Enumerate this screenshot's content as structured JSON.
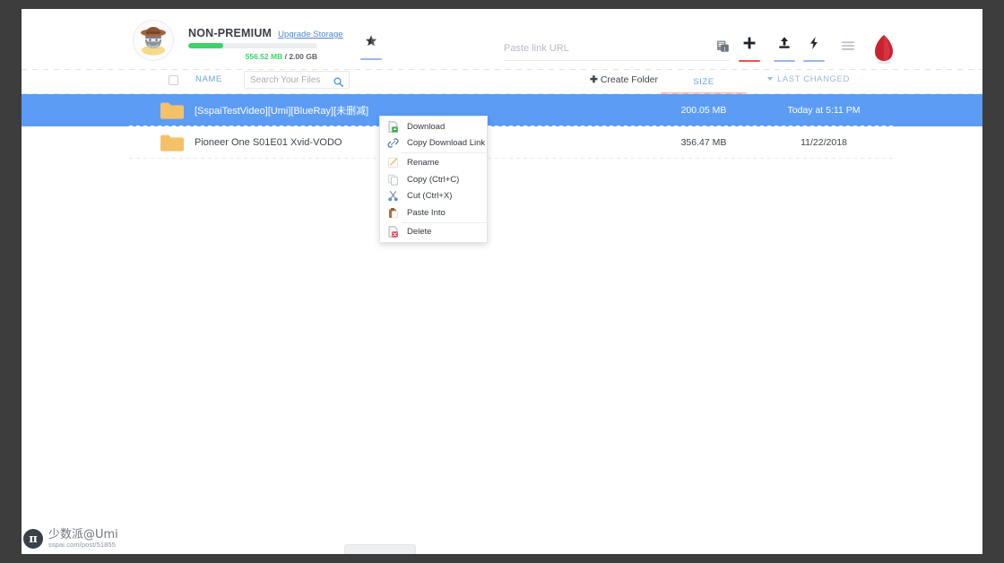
{
  "account": {
    "plan_name": "NON-PREMIUM",
    "upgrade_label": "Upgrade Storage",
    "storage_used": "556.52 MB",
    "storage_sep": "/",
    "storage_total": "2.00 GB",
    "storage_percent": 27,
    "avatar_alt": "user-avatar"
  },
  "toolbar": {
    "star_icon": "star-icon",
    "link_input_placeholder": "Paste link URL",
    "link_input_value": "",
    "paste_icon": "paste-clipboard-icon",
    "add_icon": "plus-icon",
    "upload_icon": "upload-icon",
    "bolt_icon": "lightning-bolt-icon",
    "menu_icon": "hamburger-menu-icon",
    "logo_icon": "red-leaf-logo"
  },
  "table": {
    "select_all_checked": false,
    "col_name": "NAME",
    "search_placeholder": "Search Your Files",
    "search_value": "",
    "search_icon": "search-icon",
    "create_folder_label": "Create Folder",
    "create_folder_plus": "✚",
    "col_size": "SIZE",
    "col_last_changed": "LAST CHANGED",
    "sort_active_column": "SIZE",
    "rows": [
      {
        "name": "[SspaiTestVideo][Umi][BlueRay][未删减]",
        "size": "200.05 MB",
        "changed": "Today at 5:11 PM",
        "selected": true,
        "icon": "folder-icon"
      },
      {
        "name": "Pioneer One S01E01 Xvid-VODO",
        "size": "356.47 MB",
        "changed": "11/22/2018",
        "selected": false,
        "icon": "folder-icon"
      }
    ]
  },
  "context_menu": {
    "items": [
      {
        "label": "Download",
        "icon": "download-icon"
      },
      {
        "label": "Copy Download Link",
        "icon": "link-chain-icon"
      },
      {
        "label": "Rename",
        "icon": "pencil-icon"
      },
      {
        "label": "Copy (Ctrl+C)",
        "icon": "copy-pages-icon"
      },
      {
        "label": "Cut (Ctrl+X)",
        "icon": "scissors-icon"
      },
      {
        "label": "Paste Into",
        "icon": "paste-into-icon"
      },
      {
        "label": "Delete",
        "icon": "delete-icon"
      }
    ]
  },
  "watermark": {
    "logo_glyph": "π",
    "name": "少数派@Umi",
    "url": "sspai.com/post/51855"
  },
  "colors": {
    "selection_blue": "#5c9cf5",
    "accent_blue": "#6fa3e0",
    "storage_green": "#3fd16b",
    "accent_red": "#e8554d",
    "folder_yellow": "#f5c168",
    "frame_gray": "#3d3d3d"
  }
}
